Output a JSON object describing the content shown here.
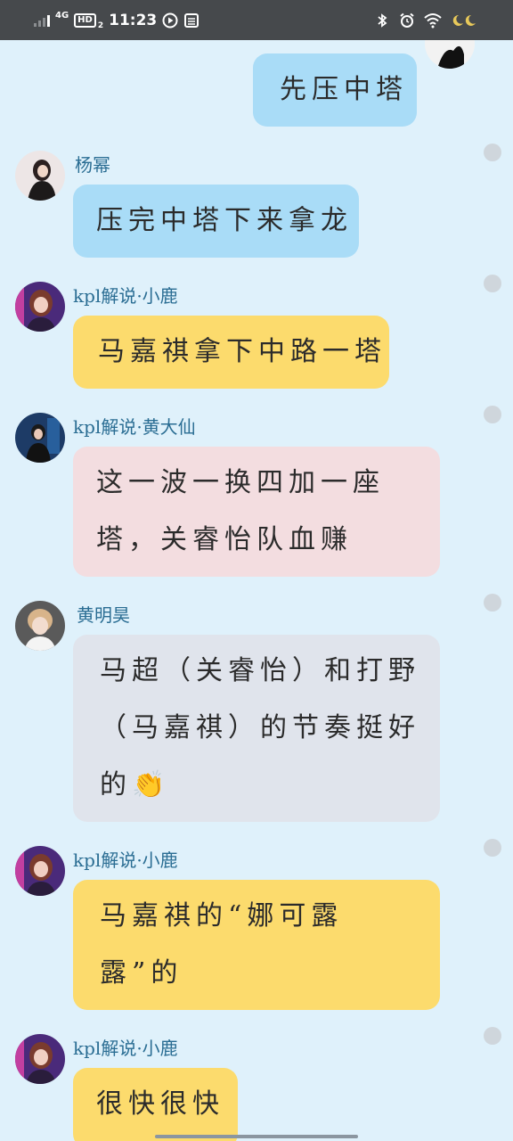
{
  "status_bar": {
    "network": "4G",
    "hd": "HD",
    "hd_sub": "2",
    "time": "11:23",
    "icons": [
      "signal-icon",
      "play-icon",
      "calendar-icon",
      "bluetooth-icon",
      "alarm-icon",
      "wifi-icon",
      "moon-icon"
    ]
  },
  "messages": [
    {
      "side": "right",
      "sender": "",
      "text": "先压中塔"
    },
    {
      "side": "left",
      "sender": "杨幂",
      "text": "压完中塔下来拿龙"
    },
    {
      "side": "left",
      "sender": "kpl解说·小鹿",
      "text": "马嘉祺拿下中路一塔"
    },
    {
      "side": "left",
      "sender": "kpl解说·黄大仙",
      "text_lines": [
        "这一波一换四加一座",
        "塔，关睿怡队血赚"
      ]
    },
    {
      "side": "left",
      "sender": "黄明昊",
      "text_lines": [
        "马超（关睿怡）和打野",
        "（马嘉祺）的节奏挺好",
        "的👏"
      ]
    },
    {
      "side": "left",
      "sender": "kpl解说·小鹿",
      "text_lines": [
        "马嘉祺的“娜可露",
        "露”的"
      ]
    },
    {
      "side": "left",
      "sender": "kpl解说·小鹿",
      "text": "很快很快"
    }
  ],
  "colors": {
    "background": "#dff1fb",
    "status_bar": "#46494c",
    "bubble_blue": "#a9dcf7",
    "bubble_yellow": "#fcdb6d",
    "bubble_pink": "#f3dde0",
    "bubble_gray": "#e0e4ec",
    "sender_name": "#2a6d93"
  }
}
